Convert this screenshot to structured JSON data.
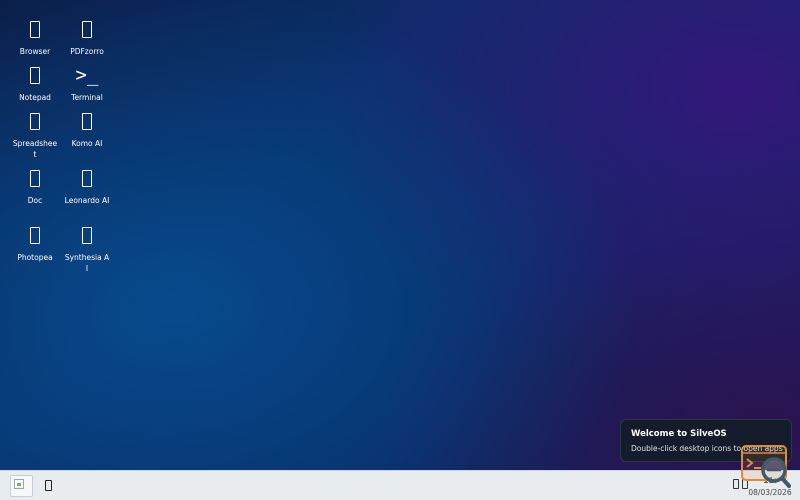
{
  "desktop": {
    "icons": [
      {
        "label": "Browser",
        "glyph": "box"
      },
      {
        "label": "PDFzorro",
        "glyph": "box"
      },
      {
        "label": "Notepad",
        "glyph": "box"
      },
      {
        "label": "Terminal",
        "glyph": ">_"
      },
      {
        "label": "Spreadsheet",
        "glyph": "box"
      },
      {
        "label": "Komo AI",
        "glyph": "box"
      },
      {
        "label": "Doc",
        "glyph": "box"
      },
      {
        "label": "Leonardo AI",
        "glyph": "box"
      },
      {
        "label": "Photopea",
        "glyph": "box"
      },
      {
        "label": "Synthesia AI",
        "glyph": "box"
      }
    ]
  },
  "notification": {
    "title": "Welcome to SilveOS",
    "body": "Double-click desktop icons to open apps"
  },
  "taskbar": {
    "clock_time": "11:",
    "clock_date": "08/03/2026"
  },
  "colors": {
    "wallpaper_primary": "#0a2f6a",
    "wallpaper_accent": "#33187a",
    "taskbar_bg": "#e9ecef",
    "overlay_accent": "#e08a3c",
    "overlay_lens": "#3d5c66"
  }
}
